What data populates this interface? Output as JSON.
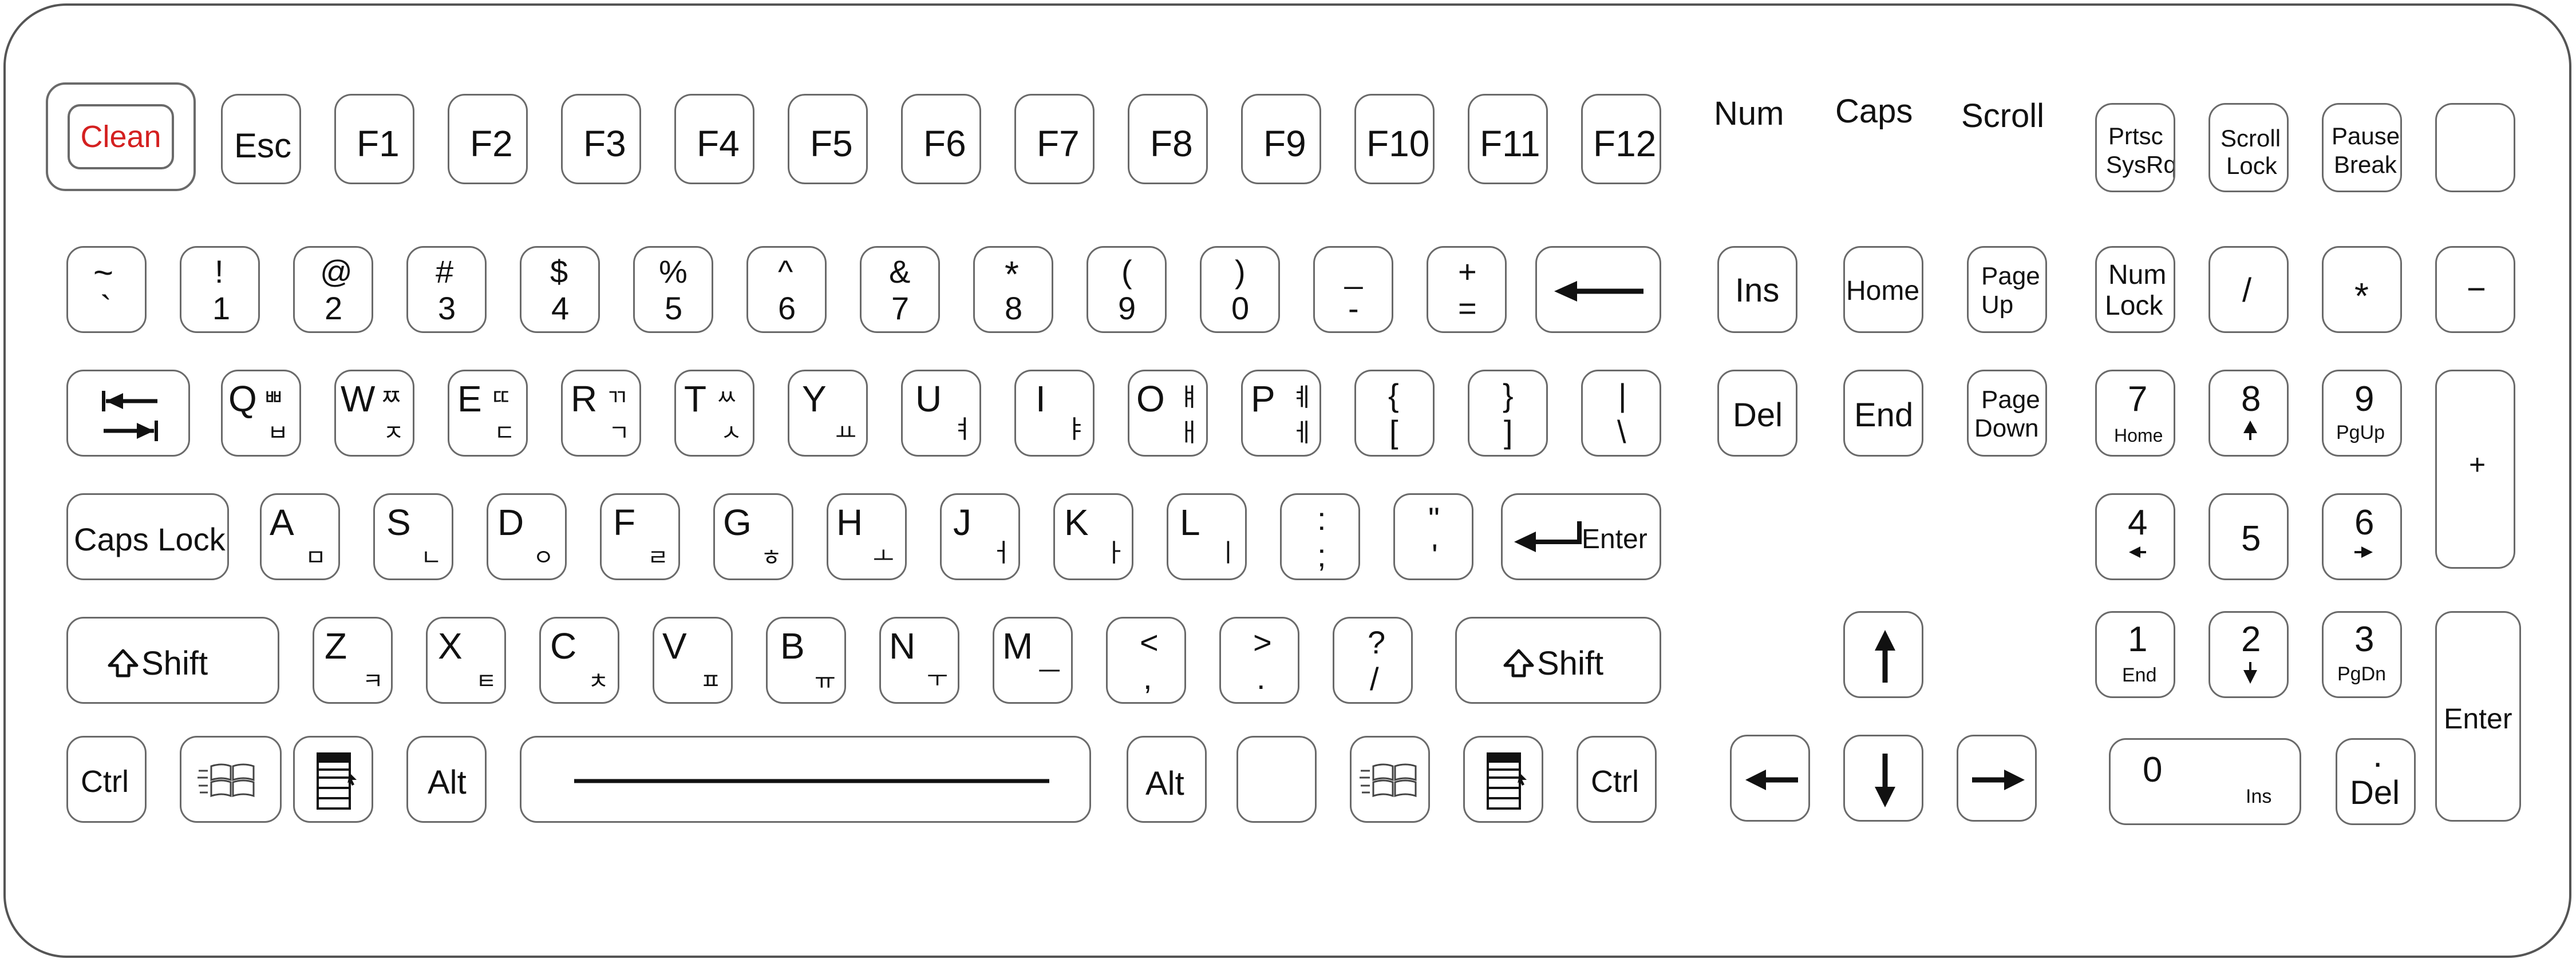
{
  "indicators": [
    "Num",
    "Caps",
    "Scroll"
  ],
  "keys": {
    "clean": "Clean",
    "esc": "Esc",
    "f": [
      "F1",
      "F2",
      "F3",
      "F4",
      "F5",
      "F6",
      "F7",
      "F8",
      "F9",
      "F10",
      "F11",
      "F12"
    ],
    "prtsc": [
      "Prtsc",
      "SysRq"
    ],
    "scroll_lock": [
      "Scroll",
      "Lock"
    ],
    "pause": [
      "Pause",
      "Break"
    ],
    "number_row": [
      [
        "~",
        "`"
      ],
      [
        "!",
        "1"
      ],
      [
        "@",
        "2"
      ],
      [
        "#",
        "3"
      ],
      [
        "$",
        "4"
      ],
      [
        "%",
        "5"
      ],
      [
        "^",
        "6"
      ],
      [
        "&",
        "7"
      ],
      [
        "*",
        "8"
      ],
      [
        "(",
        "9"
      ],
      [
        ")",
        "0"
      ],
      [
        "_",
        "-"
      ],
      [
        "+",
        "="
      ]
    ],
    "qwerty_row": [
      [
        "Q",
        "ㅃ",
        "ㅂ"
      ],
      [
        "W",
        "ㅉ",
        "ㅈ"
      ],
      [
        "E",
        "ㄸ",
        "ㄷ"
      ],
      [
        "R",
        "ㄲ",
        "ㄱ"
      ],
      [
        "T",
        "ㅆ",
        "ㅅ"
      ],
      [
        "Y",
        "",
        "ㅛ"
      ],
      [
        "U",
        "",
        "ㅕ"
      ],
      [
        "I",
        "",
        "ㅑ"
      ],
      [
        "O",
        "ㅒ",
        "ㅐ"
      ],
      [
        "P",
        "ㅖ",
        "ㅔ"
      ]
    ],
    "bracket_row": [
      [
        "{",
        "["
      ],
      [
        "}",
        "]"
      ],
      [
        "|",
        "\\"
      ]
    ],
    "caps_lock": "Caps Lock",
    "asdf_row": [
      [
        "A",
        "ㅁ"
      ],
      [
        "S",
        "ㄴ"
      ],
      [
        "D",
        "ㅇ"
      ],
      [
        "F",
        "ㄹ"
      ],
      [
        "G",
        "ㅎ"
      ],
      [
        "H",
        "ㅗ"
      ],
      [
        "J",
        "ㅓ"
      ],
      [
        "K",
        "ㅏ"
      ],
      [
        "L",
        "ㅣ"
      ]
    ],
    "semicolon": [
      ":",
      ";"
    ],
    "quote": [
      "\"",
      "'"
    ],
    "enter": "Enter",
    "shift": "Shift",
    "zxcv_row": [
      [
        "Z",
        "ㅋ"
      ],
      [
        "X",
        "ㅌ"
      ],
      [
        "C",
        "ㅊ"
      ],
      [
        "V",
        "ㅍ"
      ],
      [
        "B",
        "ㅠ"
      ],
      [
        "N",
        "ㅜ"
      ],
      [
        "M",
        "ㅡ"
      ]
    ],
    "comma": [
      "<",
      ","
    ],
    "period": [
      ">",
      "."
    ],
    "slash": [
      "?",
      "/"
    ],
    "ctrl": "Ctrl",
    "alt": "Alt",
    "nav": {
      "ins": "Ins",
      "home": "Home",
      "page_up": [
        "Page",
        "Up"
      ],
      "del": "Del",
      "end": "End",
      "page_down": [
        "Page",
        "Down"
      ]
    },
    "numpad": {
      "num_lock": [
        "Num",
        "Lock"
      ],
      "divide": "/",
      "multiply": "*",
      "minus": "−",
      "plus": "+",
      "n7": [
        "7",
        "Home"
      ],
      "n8": "8",
      "n9": [
        "9",
        "PgUp"
      ],
      "n4": "4",
      "n5": "5",
      "n6": "6",
      "n1": [
        "1",
        "End"
      ],
      "n2": "2",
      "n3": [
        "3",
        "PgDn"
      ],
      "n0": [
        "0",
        "Ins"
      ],
      "ndel": [
        ".",
        "Del"
      ],
      "enter": "Enter"
    }
  },
  "colors": {
    "clean_text": "#d42020",
    "outline": "#6a6a6a"
  }
}
